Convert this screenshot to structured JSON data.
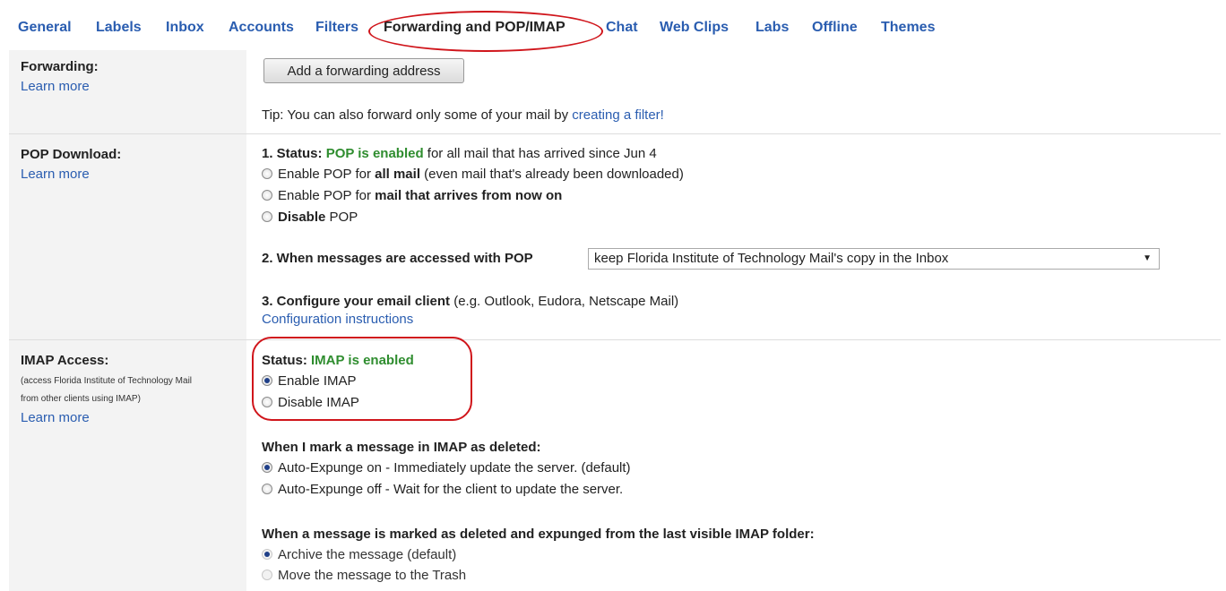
{
  "tabs": [
    {
      "label": "General"
    },
    {
      "label": "Labels"
    },
    {
      "label": "Inbox"
    },
    {
      "label": "Accounts"
    },
    {
      "label": "Filters"
    },
    {
      "label": "Forwarding and POP/IMAP"
    },
    {
      "label": "Chat"
    },
    {
      "label": "Web Clips"
    },
    {
      "label": "Labs"
    },
    {
      "label": "Offline"
    },
    {
      "label": "Themes"
    }
  ],
  "forwarding": {
    "heading": "Forwarding:",
    "learn_more": "Learn more",
    "button": "Add a forwarding address",
    "tip_prefix": "Tip: You can also forward only some of your mail by ",
    "tip_link": "creating a filter!"
  },
  "pop": {
    "heading": "POP Download:",
    "learn_more": "Learn more",
    "status_label": "1. Status: ",
    "status_value": "POP is enabled",
    "status_suffix": " for all mail that has arrived since Jun 4",
    "opt1_a": "Enable POP for ",
    "opt1_b": "all mail",
    "opt1_c": " (even mail that's already been downloaded)",
    "opt2_a": "Enable POP for ",
    "opt2_b": "mail that arrives from now on",
    "opt3_a": "Disable",
    "opt3_b": " POP",
    "when_label": "2. When messages are accessed with POP",
    "when_value": "keep Florida Institute of Technology Mail's copy in the Inbox",
    "config_label": "3. Configure your email client",
    "config_suffix": " (e.g. Outlook, Eudora, Netscape Mail)",
    "config_link": "Configuration instructions"
  },
  "imap": {
    "heading": "IMAP Access:",
    "desc1": "(access Florida Institute of Technology Mail",
    "desc2": "from other clients using IMAP)",
    "learn_more": "Learn more",
    "status_label": "Status: ",
    "status_value": "IMAP is enabled",
    "enable": "Enable IMAP",
    "disable": "Disable IMAP",
    "deleted_heading": "When I mark a message in IMAP as deleted:",
    "exp_on": "Auto-Expunge on - Immediately update the server. (default)",
    "exp_off": "Auto-Expunge off - Wait for the client to update the server.",
    "expunged_heading": "When a message is marked as deleted and expunged from the last visible IMAP folder:",
    "archive": "Archive the message (default)",
    "trash": "Move the message to the Trash"
  }
}
